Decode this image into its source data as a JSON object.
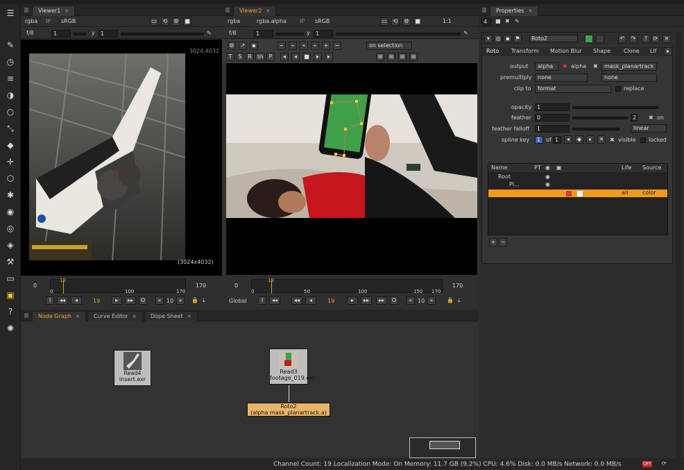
{
  "menubar": {
    "visible": true
  },
  "toolbar": {
    "icons": [
      "roto-paint-icon",
      "time-icon",
      "layers-icon",
      "color-wheel-icon",
      "circle-icon",
      "curve-icon",
      "stack-icon",
      "transform-icon",
      "3d-cube-icon",
      "particles-icon",
      "deep-icon",
      "views-icon",
      "toolsets-icon",
      "other-icon",
      "metadata-icon",
      "ofx-icon",
      "nuke-icon"
    ]
  },
  "viewer1": {
    "tab": "Viewer1",
    "channels": "rgba",
    "colorspace": "sRGB",
    "ip": "IP",
    "fstop": "f/8",
    "frame_field": "1",
    "y_label": "y",
    "y_value": "1",
    "res_top": "3024,4032",
    "res_bottom": "(3024x4032)",
    "timeline": {
      "start": "0",
      "end": "170",
      "marks": [
        "0",
        "100",
        "170"
      ],
      "current_marker": "19",
      "current_frame": "19",
      "step": "10"
    }
  },
  "viewer2": {
    "tab": "Viewer2",
    "channels": "rgba",
    "alpha": "rgba.alpha",
    "colorspace": "sRGB",
    "ip": "IP",
    "ratio": "1:1",
    "fstop": "f/8",
    "frame_field": "1",
    "y_label": "y",
    "y_value": "1",
    "on_selection": "on selection",
    "tool_letters": [
      "T",
      "S",
      "R",
      "Sh",
      "P"
    ],
    "timeline": {
      "start": "0",
      "end": "170",
      "marks": [
        "0",
        "50",
        "100",
        "150",
        "170"
      ],
      "current_marker": "19",
      "current_frame": "19",
      "step": "10",
      "mode": "Global"
    }
  },
  "properties": {
    "tab": "Properties",
    "count": "4",
    "node_name": "Roto2",
    "tabs": [
      "Roto",
      "Transform",
      "Motion Blur",
      "Shape",
      "Clone",
      "Lif"
    ],
    "output_label": "output",
    "output_value": "alpha",
    "alpha_check": "alpha",
    "mask_value": "mask_planartrack",
    "premultiply_label": "premultiply",
    "premultiply_value": "none",
    "premultiply_value2": "none",
    "clipto_label": "clip to",
    "clipto_value": "format",
    "replace": "replace",
    "opacity_label": "opacity",
    "opacity_value": "1",
    "feather_label": "feather",
    "feather_value": "0",
    "feather_num": "2",
    "on_label": "on",
    "falloff_label": "feather falloff",
    "falloff_value": "1",
    "falloff_type": "linear",
    "splinekey_label": "spline key",
    "splinekey_value": "1",
    "of_label": "of",
    "of_value": "1",
    "visible": "visible",
    "locked": "locked",
    "tree_headers": [
      "Name",
      "PT",
      "Life",
      "Source"
    ],
    "tree_rows": [
      {
        "name": "Root"
      },
      {
        "name": "Pl..."
      },
      {
        "name": "",
        "life": "all",
        "source": "color"
      }
    ],
    "plus": "+",
    "minus": "−"
  },
  "nodegraph": {
    "tabs": [
      "Node Graph",
      "Curve Editor",
      "Dope Sheet"
    ],
    "nodes": [
      {
        "title": "Read4",
        "subtitle": "insert.exr"
      },
      {
        "title": "Read3",
        "subtitle": "footage_019.exr"
      },
      {
        "title": "Roto2",
        "subtitle": "(alpha mask_planartrack.a)"
      }
    ]
  },
  "status": {
    "text": "Channel Count: 19 Localization Mode: On Memory: 11.7 GB (9,2%) CPU: 4.6% Disk: 0.0 MB/s Network: 0.0 MB/s",
    "badge": "OFF"
  },
  "colors": {
    "accent": "#f0a030",
    "roto_node": "#e9b46a",
    "selected_row": "#f29a1e",
    "green_screen": "#3fa049"
  }
}
